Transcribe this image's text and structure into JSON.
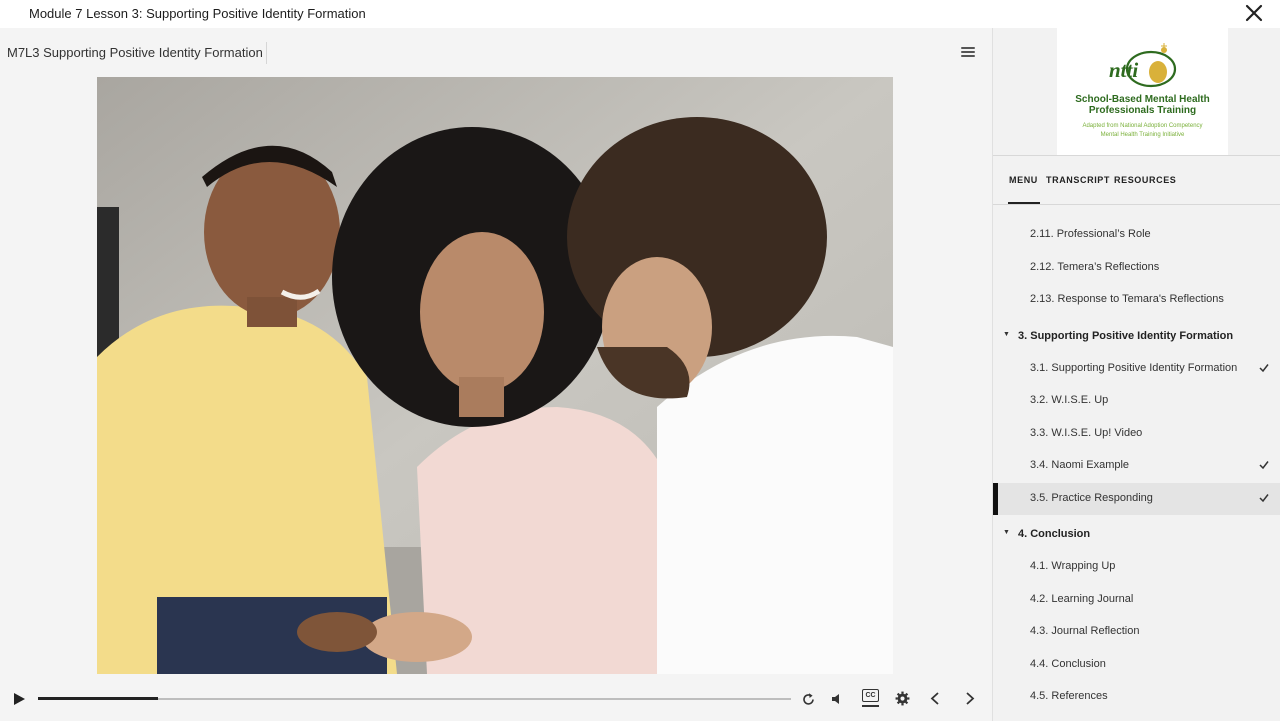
{
  "window": {
    "title": "Module 7 Lesson 3: Supporting Positive Identity Formation"
  },
  "player": {
    "lesson_title": "M7L3 Supporting Positive Identity Formation",
    "progress": 0.16
  },
  "sidebar": {
    "logo": {
      "mark": "ntti",
      "line1": "School-Based Mental Health",
      "line2": "Professionals Training",
      "line3": "Adapted from National Adoption Competency",
      "line4": "Mental Health Training Initiative"
    },
    "tabs": [
      "MENU",
      "TRANSCRIPT",
      "RESOURCES"
    ],
    "active_tab": "MENU",
    "items": [
      {
        "label": "2.11. Professional’s Role",
        "checked": false
      },
      {
        "label": "2.12. Temera’s Reflections",
        "checked": false
      },
      {
        "label": "2.13. Response to Temara's Reflections",
        "checked": false
      }
    ],
    "section3": {
      "label": "3. Supporting Positive Identity Formation",
      "items": [
        {
          "label": "3.1. Supporting Positive Identity Formation",
          "checked": true
        },
        {
          "label": "3.2. W.I.S.E. Up",
          "checked": false
        },
        {
          "label": "3.3. W.I.S.E. Up! Video",
          "checked": false
        },
        {
          "label": "3.4. Naomi Example",
          "checked": true
        },
        {
          "label": "3.5. Practice Responding",
          "checked": true,
          "active": true
        }
      ]
    },
    "section4": {
      "label": "4. Conclusion",
      "items": [
        {
          "label": "4.1. Wrapping Up",
          "checked": false
        },
        {
          "label": "4.2. Learning Journal",
          "checked": false
        },
        {
          "label": "4.3. Journal Reflection",
          "checked": false
        },
        {
          "label": "4.4. Conclusion",
          "checked": false
        },
        {
          "label": "4.5. References",
          "checked": false
        }
      ]
    }
  },
  "controls": {
    "play_icon": "play-icon",
    "replay_icon": "replay-icon",
    "volume_icon": "volume-icon",
    "cc_label": "CC",
    "settings_icon": "gear-icon",
    "prev_icon": "chevron-left-icon",
    "next_icon": "chevron-right-icon"
  },
  "colors": {
    "logo_green": "#2e6b1f",
    "logo_light_green": "#7ab03a",
    "logo_gold": "#d9b13a"
  }
}
